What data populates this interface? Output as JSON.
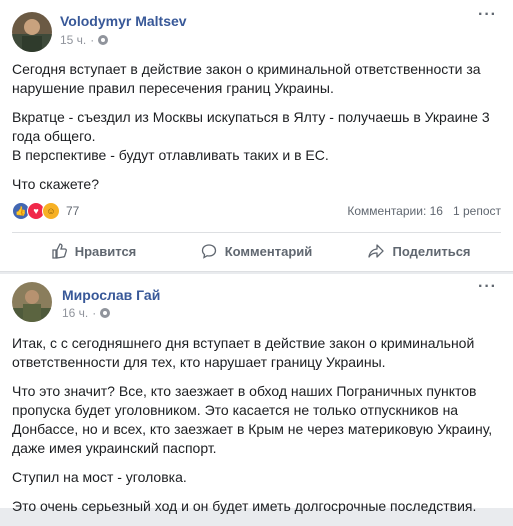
{
  "post": {
    "author": "Volodymyr Maltsev",
    "time": "15 ч.",
    "paragraphs": [
      "Сегодня вступает в действие закон о криминальной ответственности за нарушение правил пересечения границ Украины.",
      "Вкратце - съездил из Москвы искупаться в Ялту - получаешь в Украине 3 года общего.\nВ перспективе - будут отлавливать таких и в ЕС.",
      "Что скажете?"
    ],
    "reactions": {
      "icons": [
        "like-icon",
        "love-icon",
        "haha-icon"
      ],
      "count": "77"
    },
    "comments_label": "Комментарии: 16",
    "shares_label": "1 репост",
    "actions": {
      "like": "Нравится",
      "comment": "Комментарий",
      "share": "Поделиться"
    }
  },
  "second_post": {
    "author": "Мирослав Гай",
    "time": "16 ч.",
    "paragraphs": [
      "Итак, с с сегодняшнего дня вступает в действие закон о криминальной ответственности для тех, кто нарушает границу Украины.",
      "Что это значит? Все, кто заезжает в обход наших Пограничных пунктов пропуска будет уголовником. Это касается не только отпускников на Донбассе, но и всех, кто заезжает в Крым не через материковую Украину, даже имея украинский паспорт.",
      "Ступил на мост - уголовка.",
      "Это очень серьезный ход и он будет иметь долгосрочные последствия."
    ]
  },
  "colors": {
    "link": "#385898",
    "like_blue": "#4267b2",
    "love_red": "#f0284a",
    "haha_yellow": "#f7b125",
    "muted": "#606770"
  }
}
